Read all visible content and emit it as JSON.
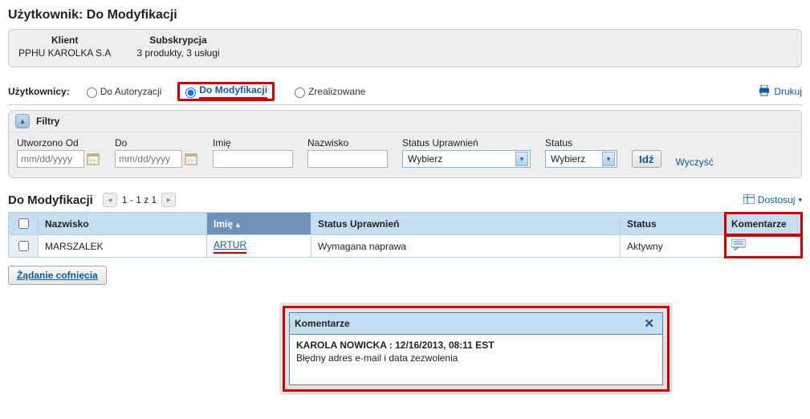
{
  "page_title": "Użytkownik: Do Modyfikacji",
  "info": {
    "client_label": "Klient",
    "client_value": "PPHU KAROLKA S.A",
    "sub_label": "Subskrypcja",
    "sub_value": "3 produkty, 3 usługi"
  },
  "filter_radio": {
    "label": "Użytkownicy:",
    "opt_auth": "Do Autoryzacji",
    "opt_mod": "Do Modyfikacji",
    "opt_done": "Zrealizowane"
  },
  "print_label": "Drukuj",
  "filters": {
    "title": "Filtry",
    "from_label": "Utworzono Od",
    "to_label": "Do",
    "date_placeholder": "mm/dd/yyyy",
    "fname_label": "Imię",
    "lname_label": "Nazwisko",
    "perm_label": "Status Uprawnień",
    "status_label": "Status",
    "select_placeholder": "Wybierz",
    "go": "Idź",
    "clear": "Wyczyść"
  },
  "grid": {
    "title": "Do Modyfikacji",
    "pager": "1 - 1 z 1",
    "customize": "Dostosuj",
    "col_nazwisko": "Nazwisko",
    "col_imie": "Imię",
    "col_perm": "Status Uprawnień",
    "col_status": "Status",
    "col_kom": "Komentarze",
    "rows": [
      {
        "nazwisko": "MARSZALEK",
        "imie": "ARTUR",
        "perm": "Wymagana naprawa",
        "status": "Aktywny"
      }
    ]
  },
  "revert_btn": "Żądanie cofnięcia",
  "popup": {
    "title": "Komentarze",
    "meta": "KAROLA NOWICKA : 12/16/2013, 08:11 EST",
    "body": "Błędny adres e-mail i data zezwolenia"
  }
}
